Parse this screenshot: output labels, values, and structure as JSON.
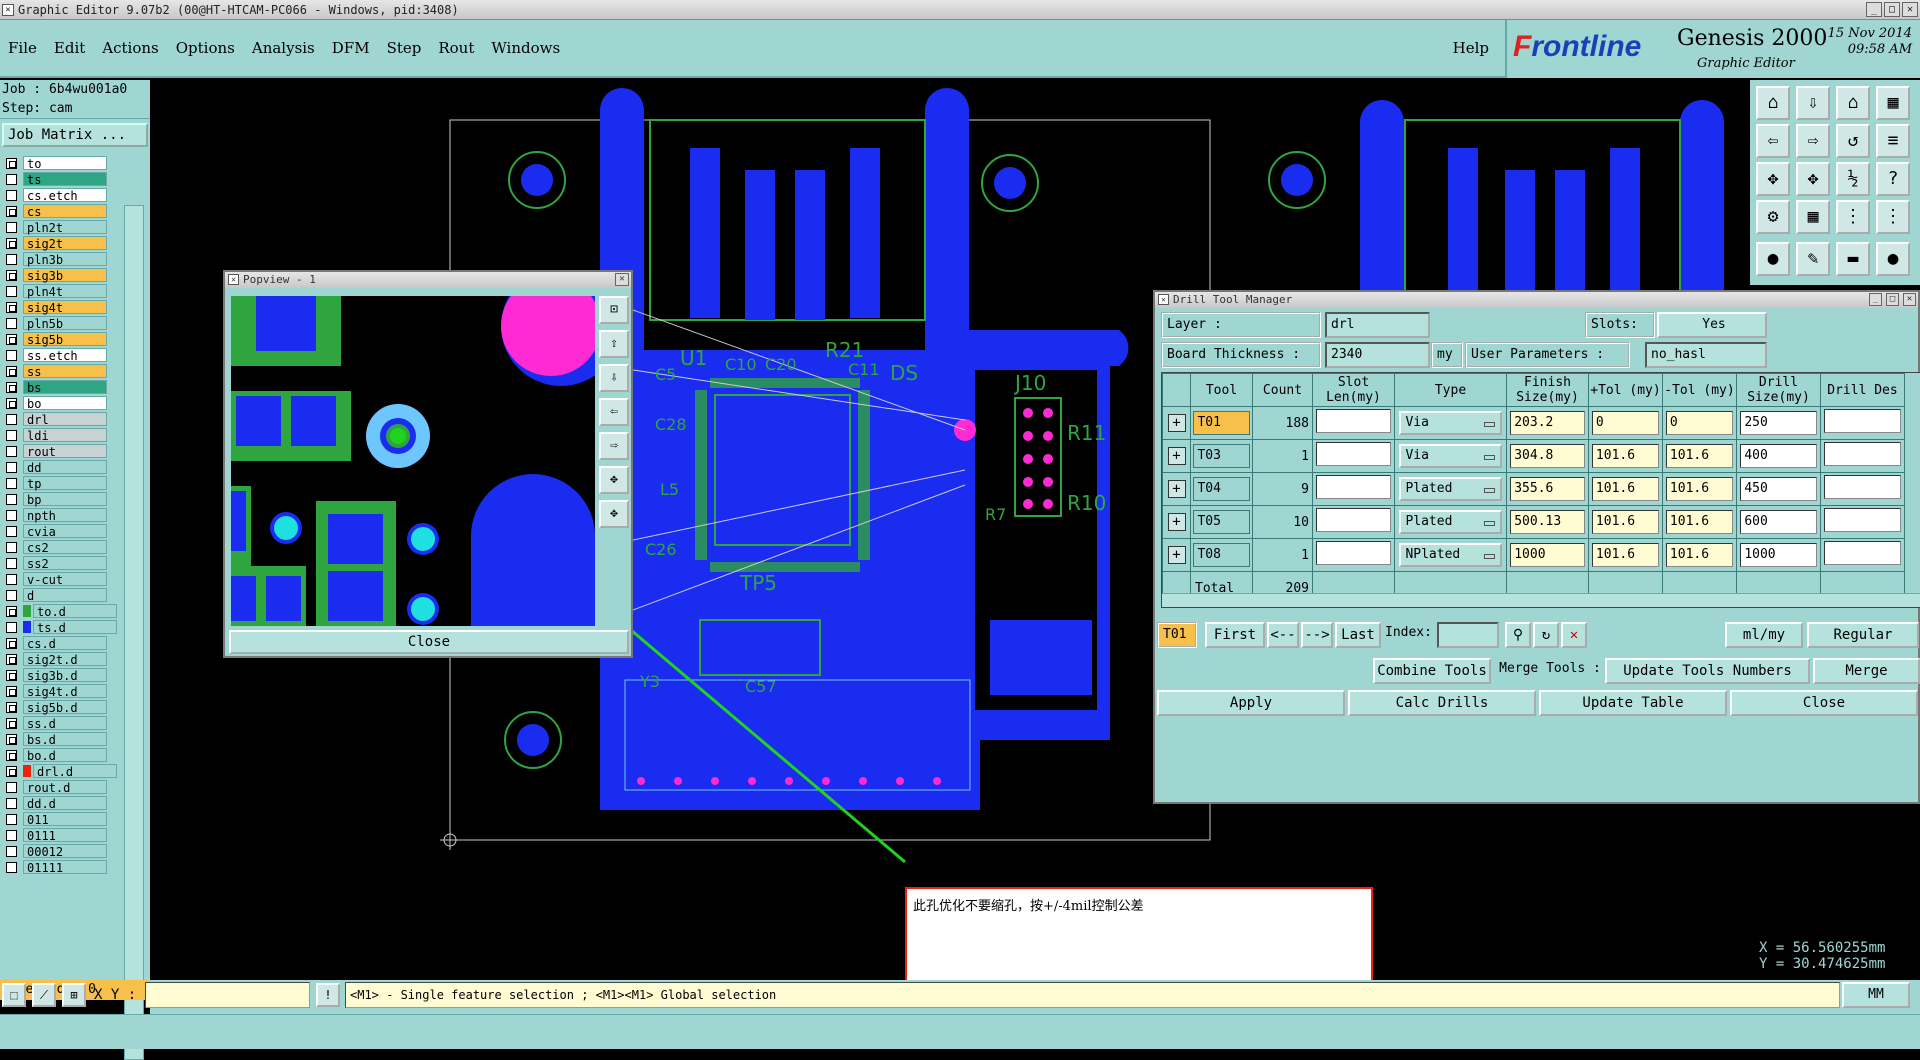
{
  "window": {
    "title": "Graphic Editor 9.07b2 (00@HT-HTCAM-PC066 - Windows, pid:3408)"
  },
  "menu": {
    "items": [
      "File",
      "Edit",
      "Actions",
      "Options",
      "Analysis",
      "DFM",
      "Step",
      "Rout",
      "Windows"
    ],
    "help": "Help"
  },
  "brand": {
    "logo_f": "F",
    "logo_rest": "rontline",
    "product": "Genesis 2000",
    "subtitle": "Graphic Editor",
    "date": "15 Nov 2014",
    "time": "09:58 AM"
  },
  "job": {
    "job_label": "Job : 6b4wu001a0",
    "step_label": "Step: cam",
    "matrix_button": "Job Matrix ..."
  },
  "layers": [
    {
      "name": "to",
      "style": "white",
      "mark": true,
      "swatch": ""
    },
    {
      "name": "ts",
      "style": "green",
      "mark": false,
      "swatch": ""
    },
    {
      "name": "cs.etch",
      "style": "white",
      "mark": false,
      "swatch": ""
    },
    {
      "name": "cs",
      "style": "orange",
      "mark": true,
      "swatch": ""
    },
    {
      "name": "pln2t",
      "style": "cyan",
      "mark": false,
      "swatch": ""
    },
    {
      "name": "sig2t",
      "style": "orange",
      "mark": true,
      "swatch": ""
    },
    {
      "name": "pln3b",
      "style": "cyan",
      "mark": false,
      "swatch": ""
    },
    {
      "name": "sig3b",
      "style": "orange",
      "mark": true,
      "swatch": ""
    },
    {
      "name": "pln4t",
      "style": "cyan",
      "mark": false,
      "swatch": ""
    },
    {
      "name": "sig4t",
      "style": "orange",
      "mark": true,
      "swatch": ""
    },
    {
      "name": "pln5b",
      "style": "cyan",
      "mark": false,
      "swatch": ""
    },
    {
      "name": "sig5b",
      "style": "orange",
      "mark": true,
      "swatch": ""
    },
    {
      "name": "ss.etch",
      "style": "white",
      "mark": false,
      "swatch": ""
    },
    {
      "name": "ss",
      "style": "orange",
      "mark": true,
      "swatch": ""
    },
    {
      "name": "bs",
      "style": "green",
      "mark": true,
      "swatch": ""
    },
    {
      "name": "bo",
      "style": "white",
      "mark": true,
      "swatch": ""
    },
    {
      "name": "drl",
      "style": "gray",
      "mark": false,
      "swatch": ""
    },
    {
      "name": "ldi",
      "style": "gray",
      "mark": false,
      "swatch": ""
    },
    {
      "name": "rout",
      "style": "gray",
      "mark": false,
      "swatch": ""
    },
    {
      "name": "dd",
      "style": "cyan",
      "mark": false,
      "swatch": ""
    },
    {
      "name": "tp",
      "style": "cyan",
      "mark": false,
      "swatch": ""
    },
    {
      "name": "bp",
      "style": "cyan",
      "mark": false,
      "swatch": ""
    },
    {
      "name": "npth",
      "style": "cyan",
      "mark": false,
      "swatch": ""
    },
    {
      "name": "cvia",
      "style": "cyan",
      "mark": false,
      "swatch": ""
    },
    {
      "name": "cs2",
      "style": "cyan",
      "mark": false,
      "swatch": ""
    },
    {
      "name": "ss2",
      "style": "cyan",
      "mark": false,
      "swatch": ""
    },
    {
      "name": "v-cut",
      "style": "cyan",
      "mark": false,
      "swatch": ""
    },
    {
      "name": "d",
      "style": "cyan",
      "mark": false,
      "swatch": ""
    },
    {
      "name": "to.d",
      "style": "cyan",
      "mark": true,
      "swatch": "#2fa540"
    },
    {
      "name": "ts.d",
      "style": "cyan",
      "mark": false,
      "swatch": "#1a2cf0"
    },
    {
      "name": "cs.d",
      "style": "cyan",
      "mark": true,
      "swatch": ""
    },
    {
      "name": "sig2t.d",
      "style": "cyan",
      "mark": true,
      "swatch": ""
    },
    {
      "name": "sig3b.d",
      "style": "cyan",
      "mark": true,
      "swatch": ""
    },
    {
      "name": "sig4t.d",
      "style": "cyan",
      "mark": true,
      "swatch": ""
    },
    {
      "name": "sig5b.d",
      "style": "cyan",
      "mark": true,
      "swatch": ""
    },
    {
      "name": "ss.d",
      "style": "cyan",
      "mark": true,
      "swatch": ""
    },
    {
      "name": "bs.d",
      "style": "cyan",
      "mark": true,
      "swatch": ""
    },
    {
      "name": "bo.d",
      "style": "cyan",
      "mark": true,
      "swatch": ""
    },
    {
      "name": "drl.d",
      "style": "cyan",
      "mark": true,
      "swatch": "#e21"
    },
    {
      "name": "rout.d",
      "style": "cyan",
      "mark": false,
      "swatch": ""
    },
    {
      "name": "dd.d",
      "style": "cyan",
      "mark": false,
      "swatch": ""
    },
    {
      "name": "011",
      "style": "cyan",
      "mark": false,
      "swatch": ""
    },
    {
      "name": "0111",
      "style": "cyan",
      "mark": false,
      "swatch": ""
    },
    {
      "name": "00012",
      "style": "cyan",
      "mark": false,
      "swatch": ""
    },
    {
      "name": "01111",
      "style": "cyan",
      "mark": false,
      "swatch": ""
    }
  ],
  "selected_label": "Selected : 0",
  "board_labels": {
    "u1": "U1",
    "c10": "C10",
    "c20": "C20",
    "r21": "R21",
    "c11": "C11",
    "c5": "C5",
    "c28": "C28",
    "l5": "L5",
    "ds": "DS",
    "j10": "J10",
    "r11": "R11",
    "r10": "R10",
    "r7": "R7",
    "c26": "C26",
    "tp5": "TP5",
    "y3": "Y3",
    "c57": "C57"
  },
  "popview": {
    "title": "Popview - 1",
    "close": "Close"
  },
  "drill": {
    "title": "Drill Tool Manager",
    "layer_label": "Layer :",
    "layer_value": "drl",
    "slots_label": "Slots:",
    "slots_value": "Yes",
    "thickness_label": "Board Thickness :",
    "thickness_value": "2340",
    "thickness_unit": "my",
    "user_params_label": "User Parameters :",
    "user_params_value": "no_hasl",
    "columns": [
      "Tool",
      "Count",
      "Slot Len(my)",
      "Type",
      "Finish Size(my)",
      "+Tol (my)",
      "-Tol (my)",
      "Drill Size(my)",
      "Drill Des"
    ],
    "rows": [
      {
        "tool": "T01",
        "count": "188",
        "slot": "",
        "type": "Via",
        "finish": "203.2",
        "ptol": "0",
        "ntol": "0",
        "drill": "250",
        "des": ""
      },
      {
        "tool": "T03",
        "count": "1",
        "slot": "",
        "type": "Via",
        "finish": "304.8",
        "ptol": "101.6",
        "ntol": "101.6",
        "drill": "400",
        "des": ""
      },
      {
        "tool": "T04",
        "count": "9",
        "slot": "",
        "type": "Plated",
        "finish": "355.6",
        "ptol": "101.6",
        "ntol": "101.6",
        "drill": "450",
        "des": ""
      },
      {
        "tool": "T05",
        "count": "10",
        "slot": "",
        "type": "Plated",
        "finish": "500.13",
        "ptol": "101.6",
        "ntol": "101.6",
        "drill": "600",
        "des": ""
      },
      {
        "tool": "T08",
        "count": "1",
        "slot": "",
        "type": "NPlated",
        "finish": "1000",
        "ptol": "101.6",
        "ntol": "101.6",
        "drill": "1000",
        "des": ""
      }
    ],
    "total_label": "Total",
    "total_value": "209",
    "current_tool": "T01",
    "nav": {
      "first": "First",
      "prev": "<--",
      "next": "-->",
      "last": "Last",
      "index": "Index:"
    },
    "units": "ml/my",
    "mode": "Regular",
    "combine": "Combine Tools",
    "merge_tools": "Merge Tools :",
    "update_numbers": "Update Tools Numbers",
    "merge": "Merge",
    "apply": "Apply",
    "calc": "Calc Drills",
    "update_table": "Update Table",
    "close": "Close"
  },
  "note": "此孔优化不要缩孔，按+/-4mil控制公差",
  "coords": {
    "x": "X =  56.560255mm",
    "y": "Y =  30.474625mm"
  },
  "status": {
    "xy_label": "X Y :",
    "hint": "<M1> - Single feature selection ; <M1><M1> Global selection",
    "units": "MM"
  },
  "colors": {
    "panel": "#9fd6d2",
    "copper": "#1a2cf0",
    "outline": "#2fa540",
    "highlight": "#f6c04a",
    "pad": "#ff2ad4",
    "note_border": "#e21"
  }
}
